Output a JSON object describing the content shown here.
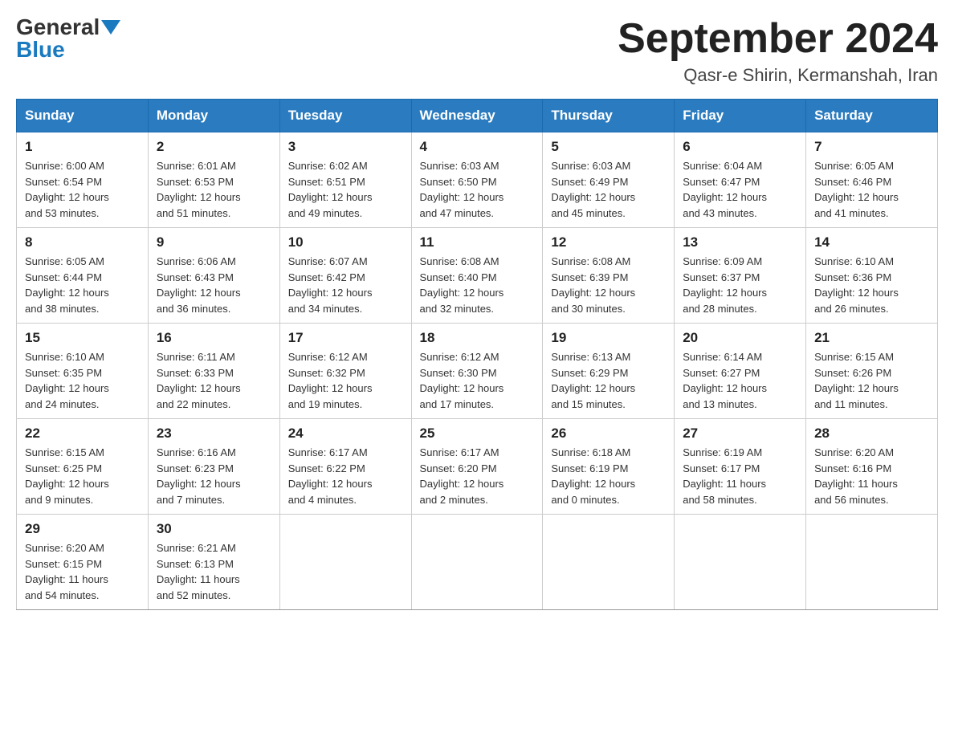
{
  "header": {
    "logo_general": "General",
    "logo_blue": "Blue",
    "month_title": "September 2024",
    "location": "Qasr-e Shirin, Kermanshah, Iran"
  },
  "weekdays": [
    "Sunday",
    "Monday",
    "Tuesday",
    "Wednesday",
    "Thursday",
    "Friday",
    "Saturday"
  ],
  "weeks": [
    [
      {
        "day": "1",
        "sunrise": "6:00 AM",
        "sunset": "6:54 PM",
        "daylight": "12 hours and 53 minutes."
      },
      {
        "day": "2",
        "sunrise": "6:01 AM",
        "sunset": "6:53 PM",
        "daylight": "12 hours and 51 minutes."
      },
      {
        "day": "3",
        "sunrise": "6:02 AM",
        "sunset": "6:51 PM",
        "daylight": "12 hours and 49 minutes."
      },
      {
        "day": "4",
        "sunrise": "6:03 AM",
        "sunset": "6:50 PM",
        "daylight": "12 hours and 47 minutes."
      },
      {
        "day": "5",
        "sunrise": "6:03 AM",
        "sunset": "6:49 PM",
        "daylight": "12 hours and 45 minutes."
      },
      {
        "day": "6",
        "sunrise": "6:04 AM",
        "sunset": "6:47 PM",
        "daylight": "12 hours and 43 minutes."
      },
      {
        "day": "7",
        "sunrise": "6:05 AM",
        "sunset": "6:46 PM",
        "daylight": "12 hours and 41 minutes."
      }
    ],
    [
      {
        "day": "8",
        "sunrise": "6:05 AM",
        "sunset": "6:44 PM",
        "daylight": "12 hours and 38 minutes."
      },
      {
        "day": "9",
        "sunrise": "6:06 AM",
        "sunset": "6:43 PM",
        "daylight": "12 hours and 36 minutes."
      },
      {
        "day": "10",
        "sunrise": "6:07 AM",
        "sunset": "6:42 PM",
        "daylight": "12 hours and 34 minutes."
      },
      {
        "day": "11",
        "sunrise": "6:08 AM",
        "sunset": "6:40 PM",
        "daylight": "12 hours and 32 minutes."
      },
      {
        "day": "12",
        "sunrise": "6:08 AM",
        "sunset": "6:39 PM",
        "daylight": "12 hours and 30 minutes."
      },
      {
        "day": "13",
        "sunrise": "6:09 AM",
        "sunset": "6:37 PM",
        "daylight": "12 hours and 28 minutes."
      },
      {
        "day": "14",
        "sunrise": "6:10 AM",
        "sunset": "6:36 PM",
        "daylight": "12 hours and 26 minutes."
      }
    ],
    [
      {
        "day": "15",
        "sunrise": "6:10 AM",
        "sunset": "6:35 PM",
        "daylight": "12 hours and 24 minutes."
      },
      {
        "day": "16",
        "sunrise": "6:11 AM",
        "sunset": "6:33 PM",
        "daylight": "12 hours and 22 minutes."
      },
      {
        "day": "17",
        "sunrise": "6:12 AM",
        "sunset": "6:32 PM",
        "daylight": "12 hours and 19 minutes."
      },
      {
        "day": "18",
        "sunrise": "6:12 AM",
        "sunset": "6:30 PM",
        "daylight": "12 hours and 17 minutes."
      },
      {
        "day": "19",
        "sunrise": "6:13 AM",
        "sunset": "6:29 PM",
        "daylight": "12 hours and 15 minutes."
      },
      {
        "day": "20",
        "sunrise": "6:14 AM",
        "sunset": "6:27 PM",
        "daylight": "12 hours and 13 minutes."
      },
      {
        "day": "21",
        "sunrise": "6:15 AM",
        "sunset": "6:26 PM",
        "daylight": "12 hours and 11 minutes."
      }
    ],
    [
      {
        "day": "22",
        "sunrise": "6:15 AM",
        "sunset": "6:25 PM",
        "daylight": "12 hours and 9 minutes."
      },
      {
        "day": "23",
        "sunrise": "6:16 AM",
        "sunset": "6:23 PM",
        "daylight": "12 hours and 7 minutes."
      },
      {
        "day": "24",
        "sunrise": "6:17 AM",
        "sunset": "6:22 PM",
        "daylight": "12 hours and 4 minutes."
      },
      {
        "day": "25",
        "sunrise": "6:17 AM",
        "sunset": "6:20 PM",
        "daylight": "12 hours and 2 minutes."
      },
      {
        "day": "26",
        "sunrise": "6:18 AM",
        "sunset": "6:19 PM",
        "daylight": "12 hours and 0 minutes."
      },
      {
        "day": "27",
        "sunrise": "6:19 AM",
        "sunset": "6:17 PM",
        "daylight": "11 hours and 58 minutes."
      },
      {
        "day": "28",
        "sunrise": "6:20 AM",
        "sunset": "6:16 PM",
        "daylight": "11 hours and 56 minutes."
      }
    ],
    [
      {
        "day": "29",
        "sunrise": "6:20 AM",
        "sunset": "6:15 PM",
        "daylight": "11 hours and 54 minutes."
      },
      {
        "day": "30",
        "sunrise": "6:21 AM",
        "sunset": "6:13 PM",
        "daylight": "11 hours and 52 minutes."
      },
      null,
      null,
      null,
      null,
      null
    ]
  ],
  "labels": {
    "sunrise": "Sunrise: ",
    "sunset": "Sunset: ",
    "daylight": "Daylight: "
  }
}
